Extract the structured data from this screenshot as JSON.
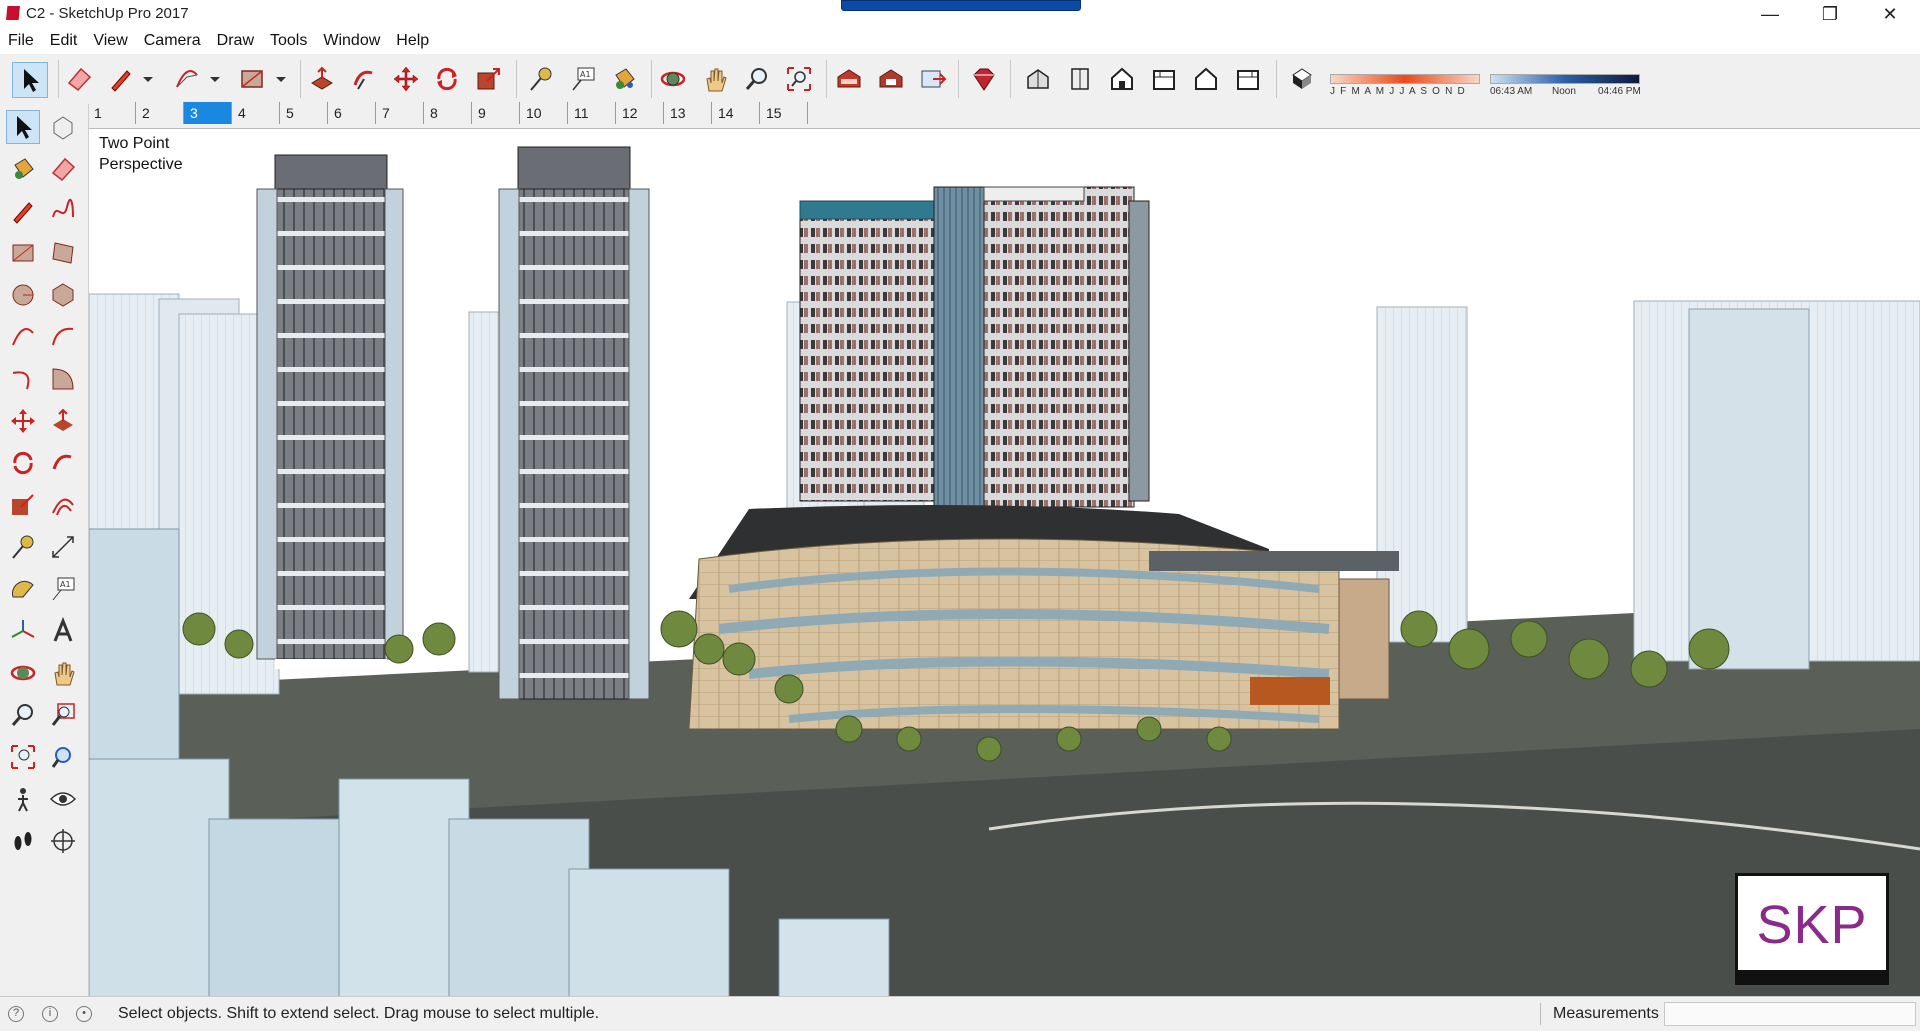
{
  "window": {
    "title": "C2 - SketchUp Pro 2017",
    "controls": [
      "—",
      "❐",
      "✕"
    ]
  },
  "menu": [
    "File",
    "Edit",
    "View",
    "Camera",
    "Draw",
    "Tools",
    "Window",
    "Help"
  ],
  "toolbar": {
    "shadow": {
      "months": "J F M A M J J A S O N D",
      "time_start": "06:43 AM",
      "time_mid": "Noon",
      "time_end": "04:46 PM"
    }
  },
  "scenes": {
    "tabs": [
      "1",
      "2",
      "3",
      "4",
      "5",
      "6",
      "7",
      "8",
      "9",
      "10",
      "11",
      "12",
      "13",
      "14",
      "15"
    ],
    "active": "3"
  },
  "viewport": {
    "camera_label": "Two Point\nPerspective",
    "watermark": "SKP"
  },
  "status": {
    "hint": "Select objects. Shift to extend select. Drag mouse to select multiple.",
    "measurements_label": "Measurements",
    "measurements_value": ""
  },
  "colors": {
    "accent": "#1a87e0",
    "brand_red": "#c8102e",
    "watermark": "#8b2a8a"
  }
}
